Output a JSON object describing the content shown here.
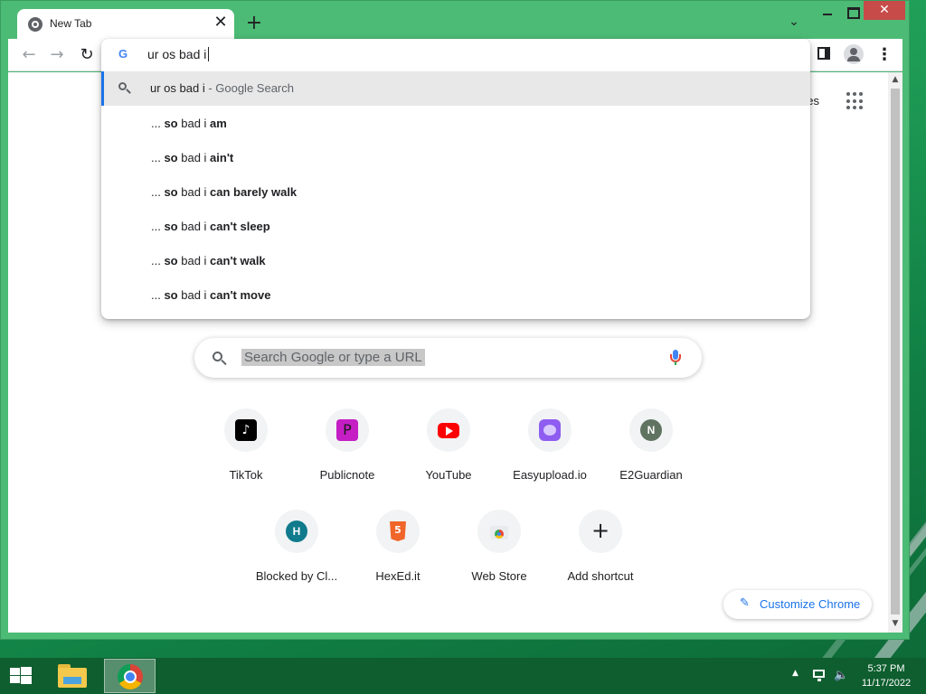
{
  "browser": {
    "tab": {
      "title": "New Tab",
      "close": "✕"
    },
    "new_tab": "+",
    "tab_search": "⌄",
    "window_controls": {
      "close": "✕"
    },
    "toolbar": {
      "back": "←",
      "forward": "→",
      "reload": "↻",
      "menu": "⋮"
    }
  },
  "omnibox": {
    "typed_text": "ur os bad i",
    "logo": "G",
    "suggestions": [
      {
        "prefix": "ur os bad i",
        "desc": " - Google Search",
        "selected": true,
        "icon": "search-icon"
      },
      {
        "ellipsis": "... ",
        "bold1": "so",
        "mid": " bad i ",
        "bold2": "am"
      },
      {
        "ellipsis": "... ",
        "bold1": "so",
        "mid": " bad i ",
        "bold2": "ain't"
      },
      {
        "ellipsis": "... ",
        "bold1": "so",
        "mid": " bad i ",
        "bold2": "can barely walk"
      },
      {
        "ellipsis": "... ",
        "bold1": "so",
        "mid": " bad i ",
        "bold2": "can't sleep"
      },
      {
        "ellipsis": "... ",
        "bold1": "so",
        "mid": " bad i ",
        "bold2": "can't walk"
      },
      {
        "ellipsis": "... ",
        "bold1": "so",
        "mid": " bad i ",
        "bold2": "can't move"
      }
    ]
  },
  "page": {
    "header": {
      "images_partial": "ges",
      "apps_icon": "apps-grid-icon"
    },
    "search": {
      "placeholder": "Search Google or type a URL"
    },
    "shortcuts": [
      {
        "label": "TikTok",
        "glyph": "♪"
      },
      {
        "label": "Publicnote",
        "glyph": "P"
      },
      {
        "label": "YouTube"
      },
      {
        "label": "Easyupload.io"
      },
      {
        "label": "E2Guardian",
        "glyph": "N"
      },
      {
        "label": "Blocked by Cl...",
        "glyph": "H"
      },
      {
        "label": "HexEd.it",
        "glyph": "5"
      },
      {
        "label": "Web Store"
      },
      {
        "label": "Add shortcut",
        "glyph": "+"
      }
    ],
    "customize": {
      "label": "Customize Chrome",
      "icon": "✎"
    }
  },
  "taskbar": {
    "time": "5:37 PM",
    "date": "11/17/2022",
    "tray_up": "▲",
    "volume": "🔈"
  },
  "colors": {
    "accent": "#1a73e8",
    "window_frame": "#4cbb75",
    "close_button": "#c74b48",
    "taskbar": "#0f5e2f"
  }
}
